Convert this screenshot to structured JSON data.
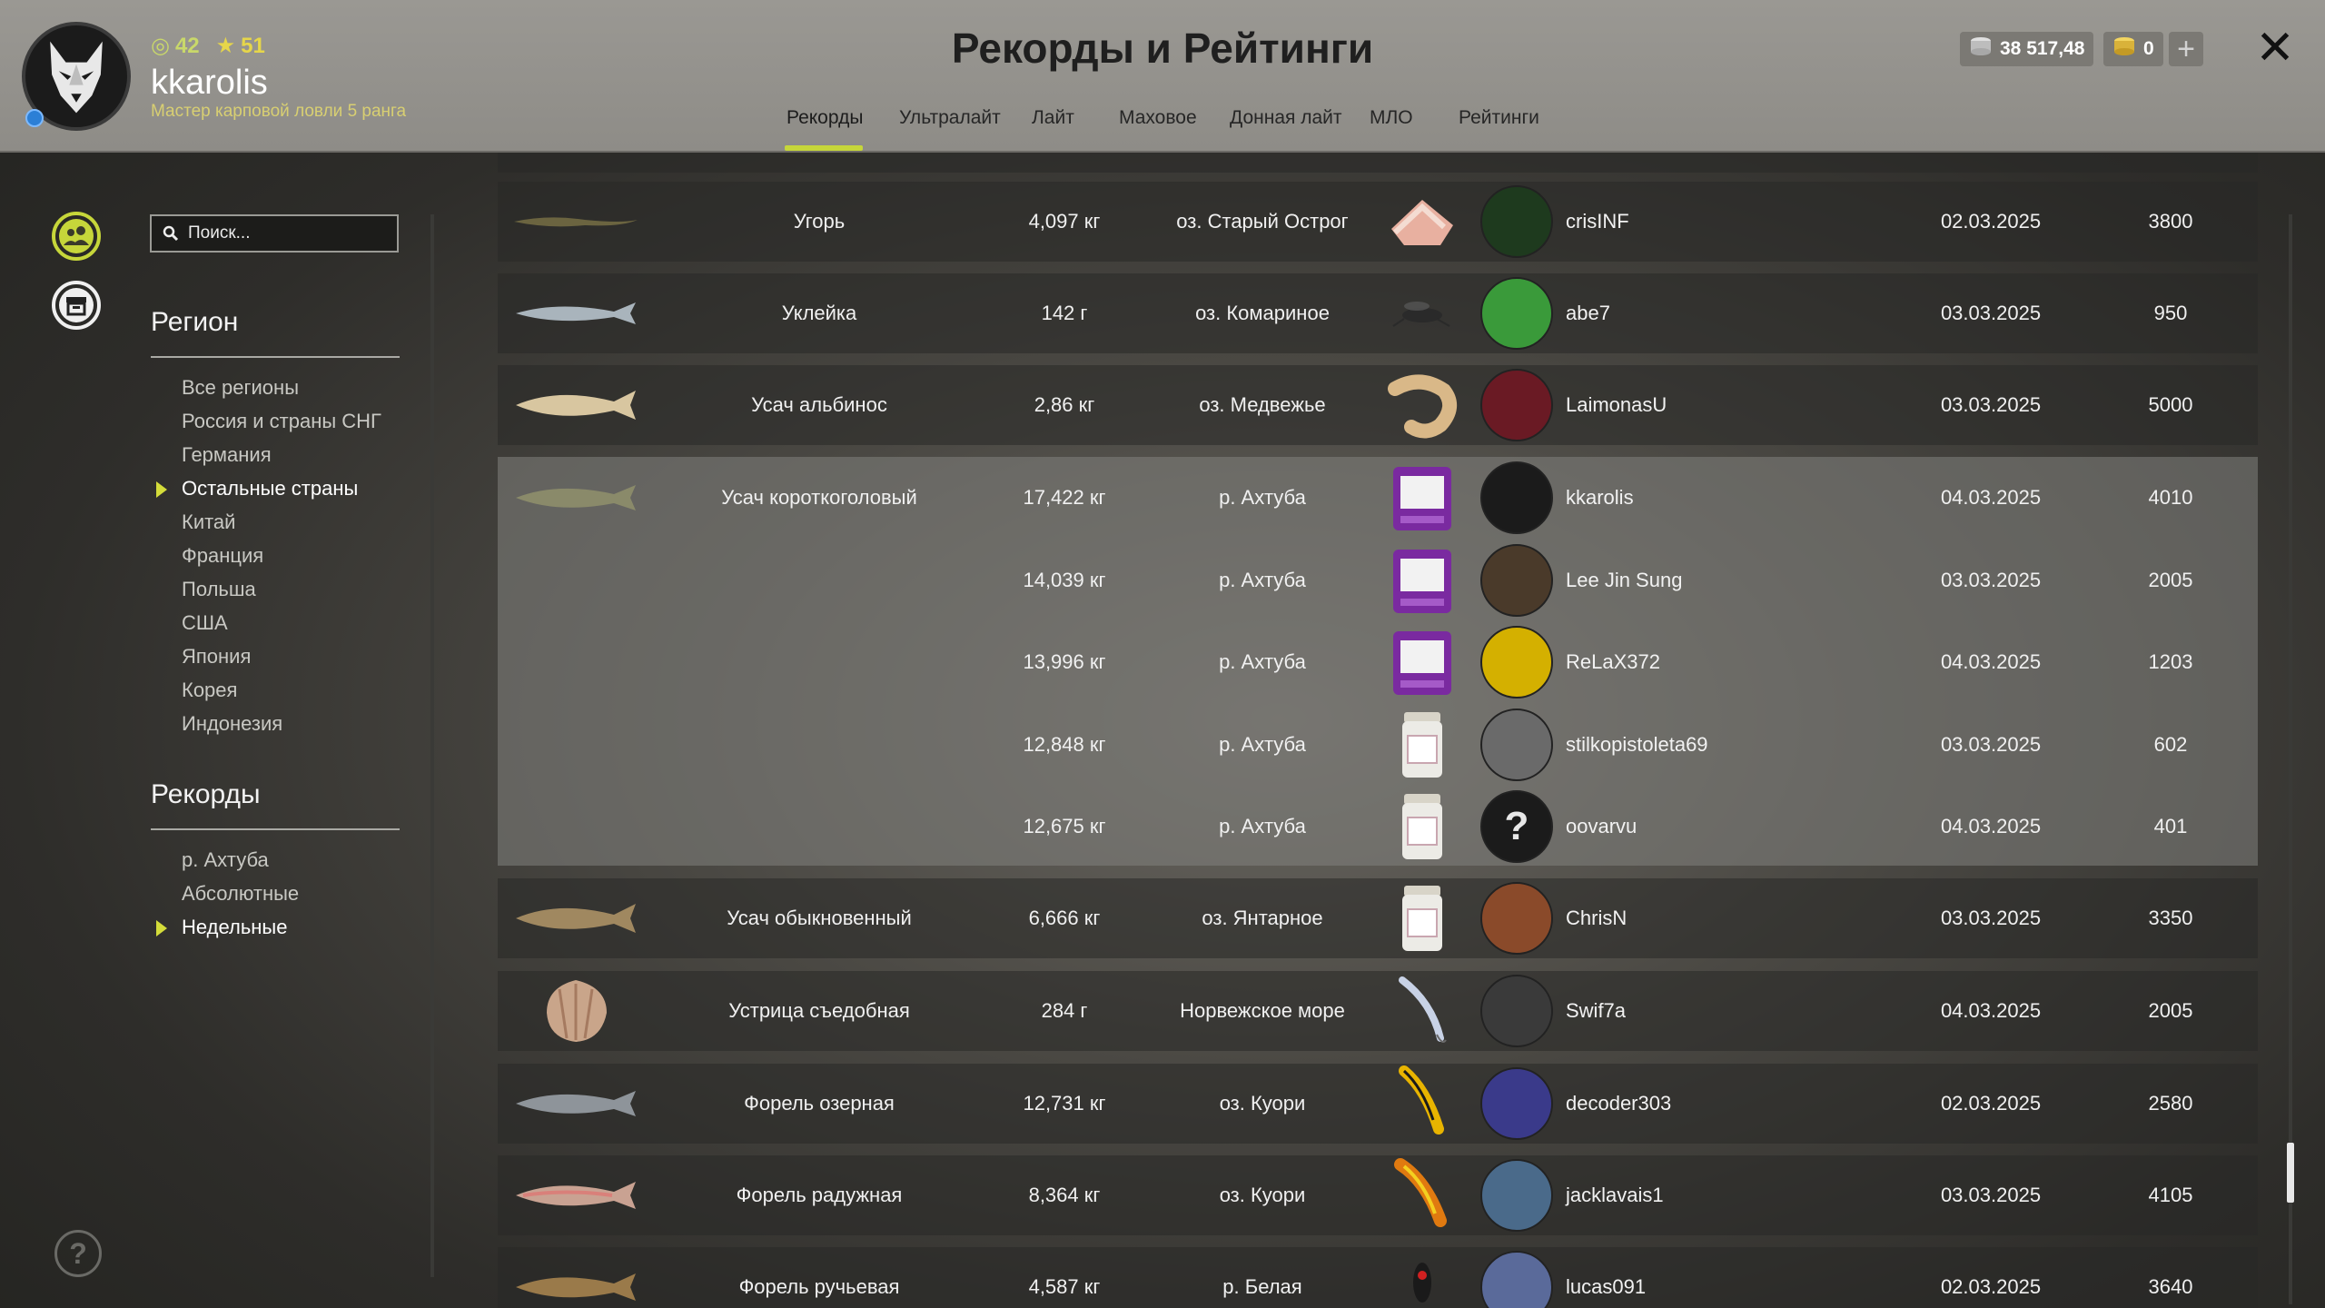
{
  "header": {
    "title": "Рекорды и Рейтинги",
    "username": "kkarolis",
    "rank_title": "Мастер карповой ловли 5 ранга",
    "level": "42",
    "stars": "51",
    "silver": "38 517,48",
    "gold": "0"
  },
  "tabs": [
    {
      "label": "Рекорды",
      "active": true
    },
    {
      "label": "Ультралайт"
    },
    {
      "label": "Лайт"
    },
    {
      "label": "Маховое"
    },
    {
      "label": "Донная лайт"
    },
    {
      "label": "МЛО"
    },
    {
      "label": "Рейтинги"
    }
  ],
  "sidebar": {
    "search_placeholder": "Поиск...",
    "region_title": "Регион",
    "regions": [
      "Все регионы",
      "Россия и страны СНГ",
      "Германия",
      "Остальные страны",
      "Китай",
      "Франция",
      "Польша",
      "США",
      "Япония",
      "Корея",
      "Индонезия"
    ],
    "records_title": "Рекорды",
    "records": [
      "р. Ахтуба",
      "Абсолютные",
      "Недельные"
    ]
  },
  "rows": [
    {
      "fish": "Угорь",
      "weight": "4,097 кг",
      "location": "оз. Старый Острог",
      "player": "crisINF",
      "date": "02.03.2025",
      "score": "3800"
    },
    {
      "fish": "Уклейка",
      "weight": "142 г",
      "location": "оз. Комариное",
      "player": "abe7",
      "date": "03.03.2025",
      "score": "950"
    },
    {
      "fish": "Усач альбинос",
      "weight": "2,86 кг",
      "location": "оз. Медвежье",
      "player": "LaimonasU",
      "date": "03.03.2025",
      "score": "5000"
    },
    {
      "fish": "Усач короткоголовый",
      "weight": "17,422 кг",
      "location": "р. Ахтуба",
      "player": "kkarolis",
      "date": "04.03.2025",
      "score": "4010"
    },
    {
      "fish": "",
      "weight": "14,039 кг",
      "location": "р. Ахтуба",
      "player": "Lee Jin Sung",
      "date": "03.03.2025",
      "score": "2005"
    },
    {
      "fish": "",
      "weight": "13,996 кг",
      "location": "р. Ахтуба",
      "player": "ReLaX372",
      "date": "04.03.2025",
      "score": "1203"
    },
    {
      "fish": "",
      "weight": "12,848 кг",
      "location": "р. Ахтуба",
      "player": "stilkopistoleta69",
      "date": "03.03.2025",
      "score": "602"
    },
    {
      "fish": "",
      "weight": "12,675 кг",
      "location": "р. Ахтуба",
      "player": "oovarvu",
      "date": "04.03.2025",
      "score": "401"
    },
    {
      "fish": "Усач обыкновенный",
      "weight": "6,666 кг",
      "location": "оз. Янтарное",
      "player": "ChrisN",
      "date": "03.03.2025",
      "score": "3350"
    },
    {
      "fish": "Устрица съедобная",
      "weight": "284 г",
      "location": "Норвежское море",
      "player": "Swif7a",
      "date": "04.03.2025",
      "score": "2005"
    },
    {
      "fish": "Форель озерная",
      "weight": "12,731 кг",
      "location": "оз. Куори",
      "player": "decoder303",
      "date": "02.03.2025",
      "score": "2580"
    },
    {
      "fish": "Форель радужная",
      "weight": "8,364 кг",
      "location": "оз. Куори",
      "player": "jacklavais1",
      "date": "03.03.2025",
      "score": "4105"
    },
    {
      "fish": "Форель ручьевая",
      "weight": "4,587 кг",
      "location": "р. Белая",
      "player": "lucas091",
      "date": "02.03.2025",
      "score": "3640"
    }
  ],
  "icons": {
    "close": "close-icon",
    "plus": "plus-icon",
    "help": "help-icon",
    "friends": "friends-icon",
    "archive": "archive-icon",
    "search": "search-icon"
  },
  "colors": {
    "accent": "#c6d63a",
    "header_bg": "#9a9893",
    "row_bg": "#2a2a28",
    "row_highlight": "#82827e"
  }
}
